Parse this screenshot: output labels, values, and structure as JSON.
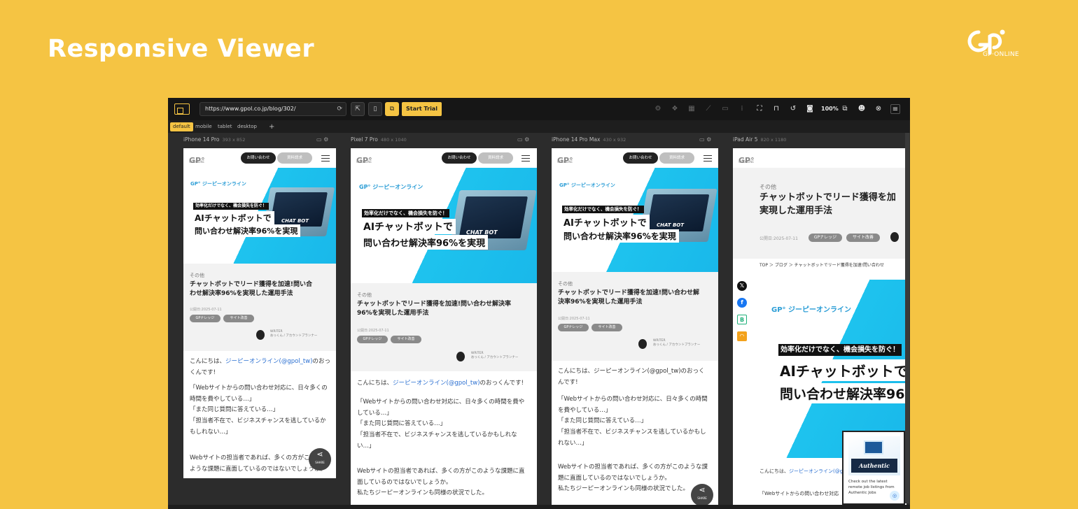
{
  "hero": {
    "title": "Responsive Viewer"
  },
  "brand": {
    "logo_text": "GP·ONLINE",
    "mark_icon": "gp-online-logo-icon"
  },
  "toolbar": {
    "url": "https://www.gpol.co.jp/blog/302/",
    "trial_label": "Start Trial",
    "zoom": "100"
  },
  "tabs": [
    "default",
    "mobile",
    "tablet",
    "desktop"
  ],
  "devices": [
    {
      "name": "iPhone 14 Pro",
      "dims": "393 x 852"
    },
    {
      "name": "Pixel 7 Pro",
      "dims": "480 x 1040"
    },
    {
      "name": "iPhone 14 Pro Max",
      "dims": "430 x 932"
    },
    {
      "name": "iPad Air 5",
      "dims": "820 x 1180"
    }
  ],
  "site": {
    "logo": "GP·ONLINE",
    "contact": "お問い合わせ",
    "download": "資料請求",
    "banner_logo": "ジーピーオンライン",
    "banner_sub": "効率化だけでなく、機会損失を防ぐ！",
    "banner_line1": "AIチャットボットで",
    "banner_line2": "問い合わせ解決率96%を実現",
    "chatbot": "CHAT BOT",
    "category": "その他",
    "title_line1": "チャットボットでリード獲得を加速!問い合",
    "title_line2": "わせ解決率96%を実現した運用手法",
    "title_wide_line1": "チャットボットでリード獲得を加速!問い合わせ解決率",
    "title_wide_line2": "96%を実現した運用手法",
    "title_mid_line1": "チャットボットでリード獲得を加速!問い合わせ解",
    "title_mid_line2": "決率96%を実現した運用手法",
    "ipad_title_line1": "チャットボットでリード獲得を加",
    "ipad_title_line2": "実現した運用手法",
    "date": "公開日:2025-07-11",
    "tag1": "GPナレッジ",
    "tag2": "サイト改善",
    "writer_label": "WRITER",
    "writer_name": "おっくん / アカウントプランナー",
    "intro_pre": "こんにちは、",
    "intro_link": "ジーピーオンライン(@gpol_tw)",
    "intro_post": "のおっくんです!",
    "ipad_breadcrumb": "TOP ＞ ブログ ＞ チャットボットでリード獲得を加速!問い合わせ",
    "share": "SHARE",
    "popup_text": "Check out the latest remote job listings from Authentic Jobs",
    "popup_brand": "Authentic"
  },
  "para_narrow": "「Webサイトからの問い合わせ対応に、日々多くの\n時間を費やしている…」\n「また同じ質問に答えている…」\n「担当者不在で、ビジネスチャンスを逃しているか\nもしれない…」",
  "para_narrow2": "Webサイトの担当者であれば、多くの方がこの\nような課題に直面しているのではないでしょうか。",
  "para_wide": "「Webサイトからの問い合わせ対応に、日々多くの時間を費や\nしている…」\n「また同じ質問に答えている…」\n「担当者不在で、ビジネスチャンスを逃しているかもしれな\nい…」",
  "para_wide2": "Webサイトの担当者であれば、多くの方がこのような課題に直\n面しているのではないでしょうか。\n私たちジーピーオンラインも同様の状況でした。",
  "para_mid_intro": "こんにちは、ジーピーオンライン(@gpol_tw)のおっく\nんです!",
  "para_mid": "「Webサイトからの問い合わせ対応に、日々多くの時間\nを費やしている…」\n「また同じ質問に答えている…」\n「担当者不在で、ビジネスチャンスを逃しているかもし\nれない…」",
  "para_mid2": "Webサイトの担当者であれば、多くの方がこのような課\n題に直面しているのではないでしょうか。\n私たちジーピーオンラインも同様の状況でした。",
  "para_ipad": "「Webサイトからの問い合わせ対応"
}
